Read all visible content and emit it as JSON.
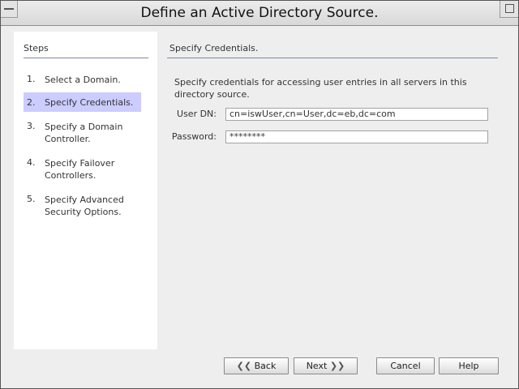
{
  "window": {
    "title": "Define an Active Directory Source."
  },
  "steps": {
    "title": "Steps",
    "items": [
      {
        "num": "1.",
        "label": "Select a Domain."
      },
      {
        "num": "2.",
        "label": "Specify Credentials."
      },
      {
        "num": "3.",
        "label": "Specify a Domain Controller."
      },
      {
        "num": "4.",
        "label": "Specify Failover Controllers."
      },
      {
        "num": "5.",
        "label": "Specify Advanced Security Options."
      }
    ]
  },
  "content": {
    "heading": "Specify Credentials.",
    "description": "Specify credentials for accessing user entries in all servers in this directory source.",
    "user_dn": {
      "label": "User DN:",
      "value": "cn=iswUser,cn=User,dc=eb,dc=com"
    },
    "password": {
      "label": "Password:",
      "value": "********"
    }
  },
  "buttons": {
    "back": "Back",
    "next": "Next",
    "cancel": "Cancel",
    "help": "Help"
  },
  "colors": {
    "current_step_highlight": "#ccccff",
    "rule": "#7d8aa3"
  }
}
